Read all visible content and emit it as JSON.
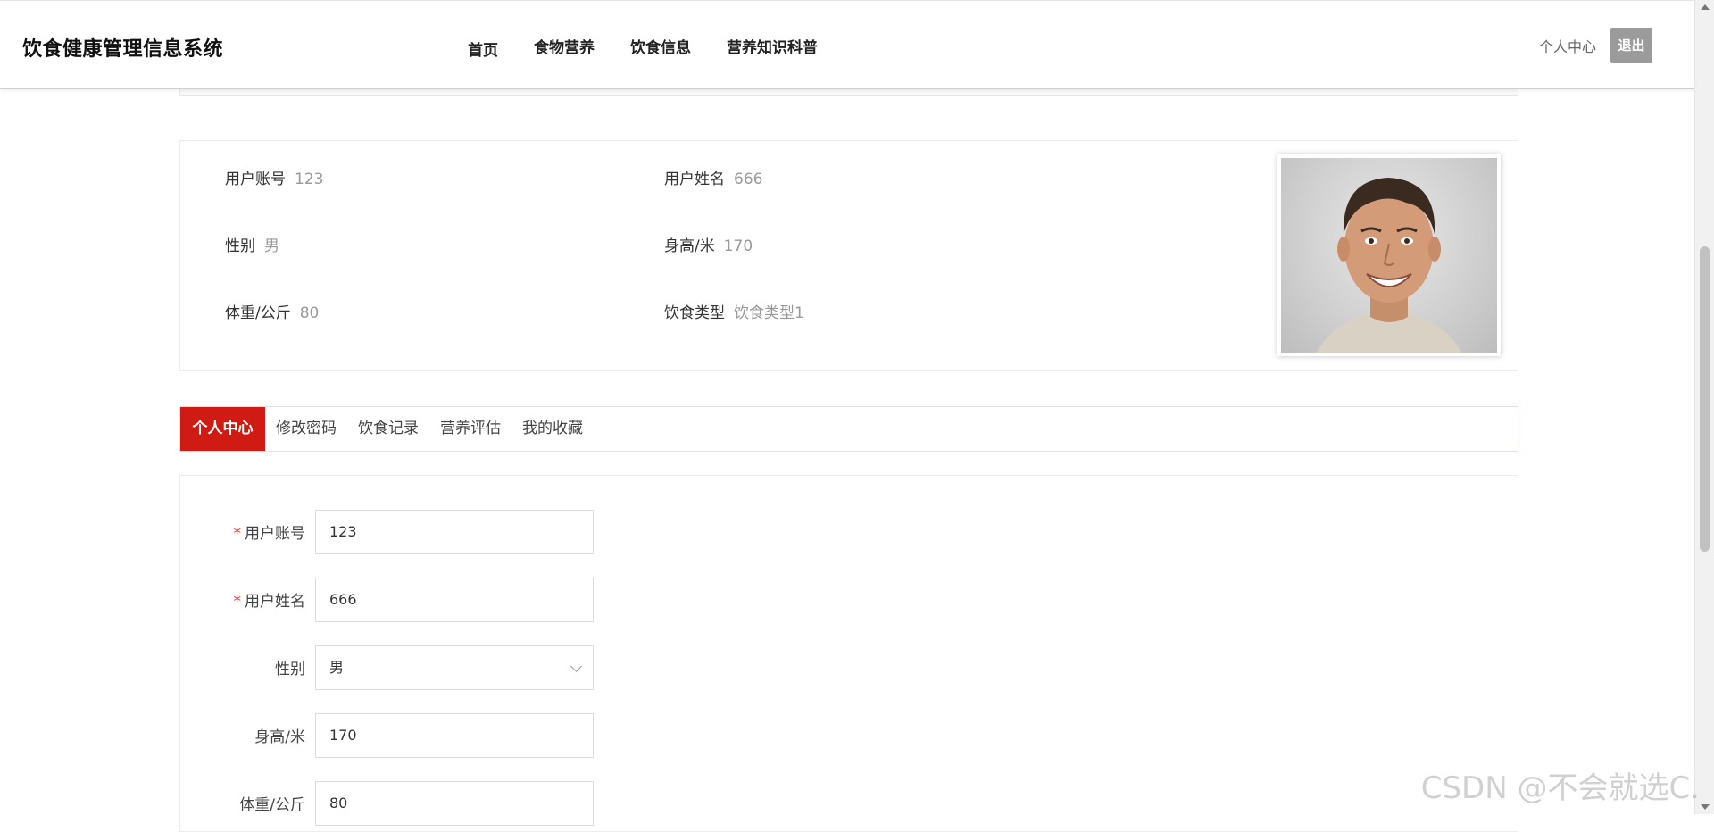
{
  "header": {
    "site_title": "饮食健康管理信息系统",
    "nav": [
      "首页",
      "食物营养",
      "饮食信息",
      "营养知识科普"
    ],
    "user_center": "个人中心",
    "logout": "退出"
  },
  "profile": {
    "account_label": "用户账号",
    "account_value": "123",
    "name_label": "用户姓名",
    "name_value": "666",
    "gender_label": "性别",
    "gender_value": "男",
    "height_label": "身高/米",
    "height_value": "170",
    "weight_label": "体重/公斤",
    "weight_value": "80",
    "diet_label": "饮食类型",
    "diet_value": "饮食类型1"
  },
  "tabs": [
    "个人中心",
    "修改密码",
    "饮食记录",
    "营养评估",
    "我的收藏"
  ],
  "form": {
    "account": {
      "label": "用户账号",
      "value": "123",
      "required": "*"
    },
    "name": {
      "label": "用户姓名",
      "value": "666",
      "required": "*"
    },
    "gender": {
      "label": "性别",
      "value": "男"
    },
    "height": {
      "label": "身高/米",
      "value": "170"
    },
    "weight": {
      "label": "体重/公斤",
      "value": "80"
    }
  },
  "watermark": "CSDN @不会就选C.",
  "colors": {
    "accent": "#cf1b14",
    "logout_bg": "#9b9b9b"
  }
}
